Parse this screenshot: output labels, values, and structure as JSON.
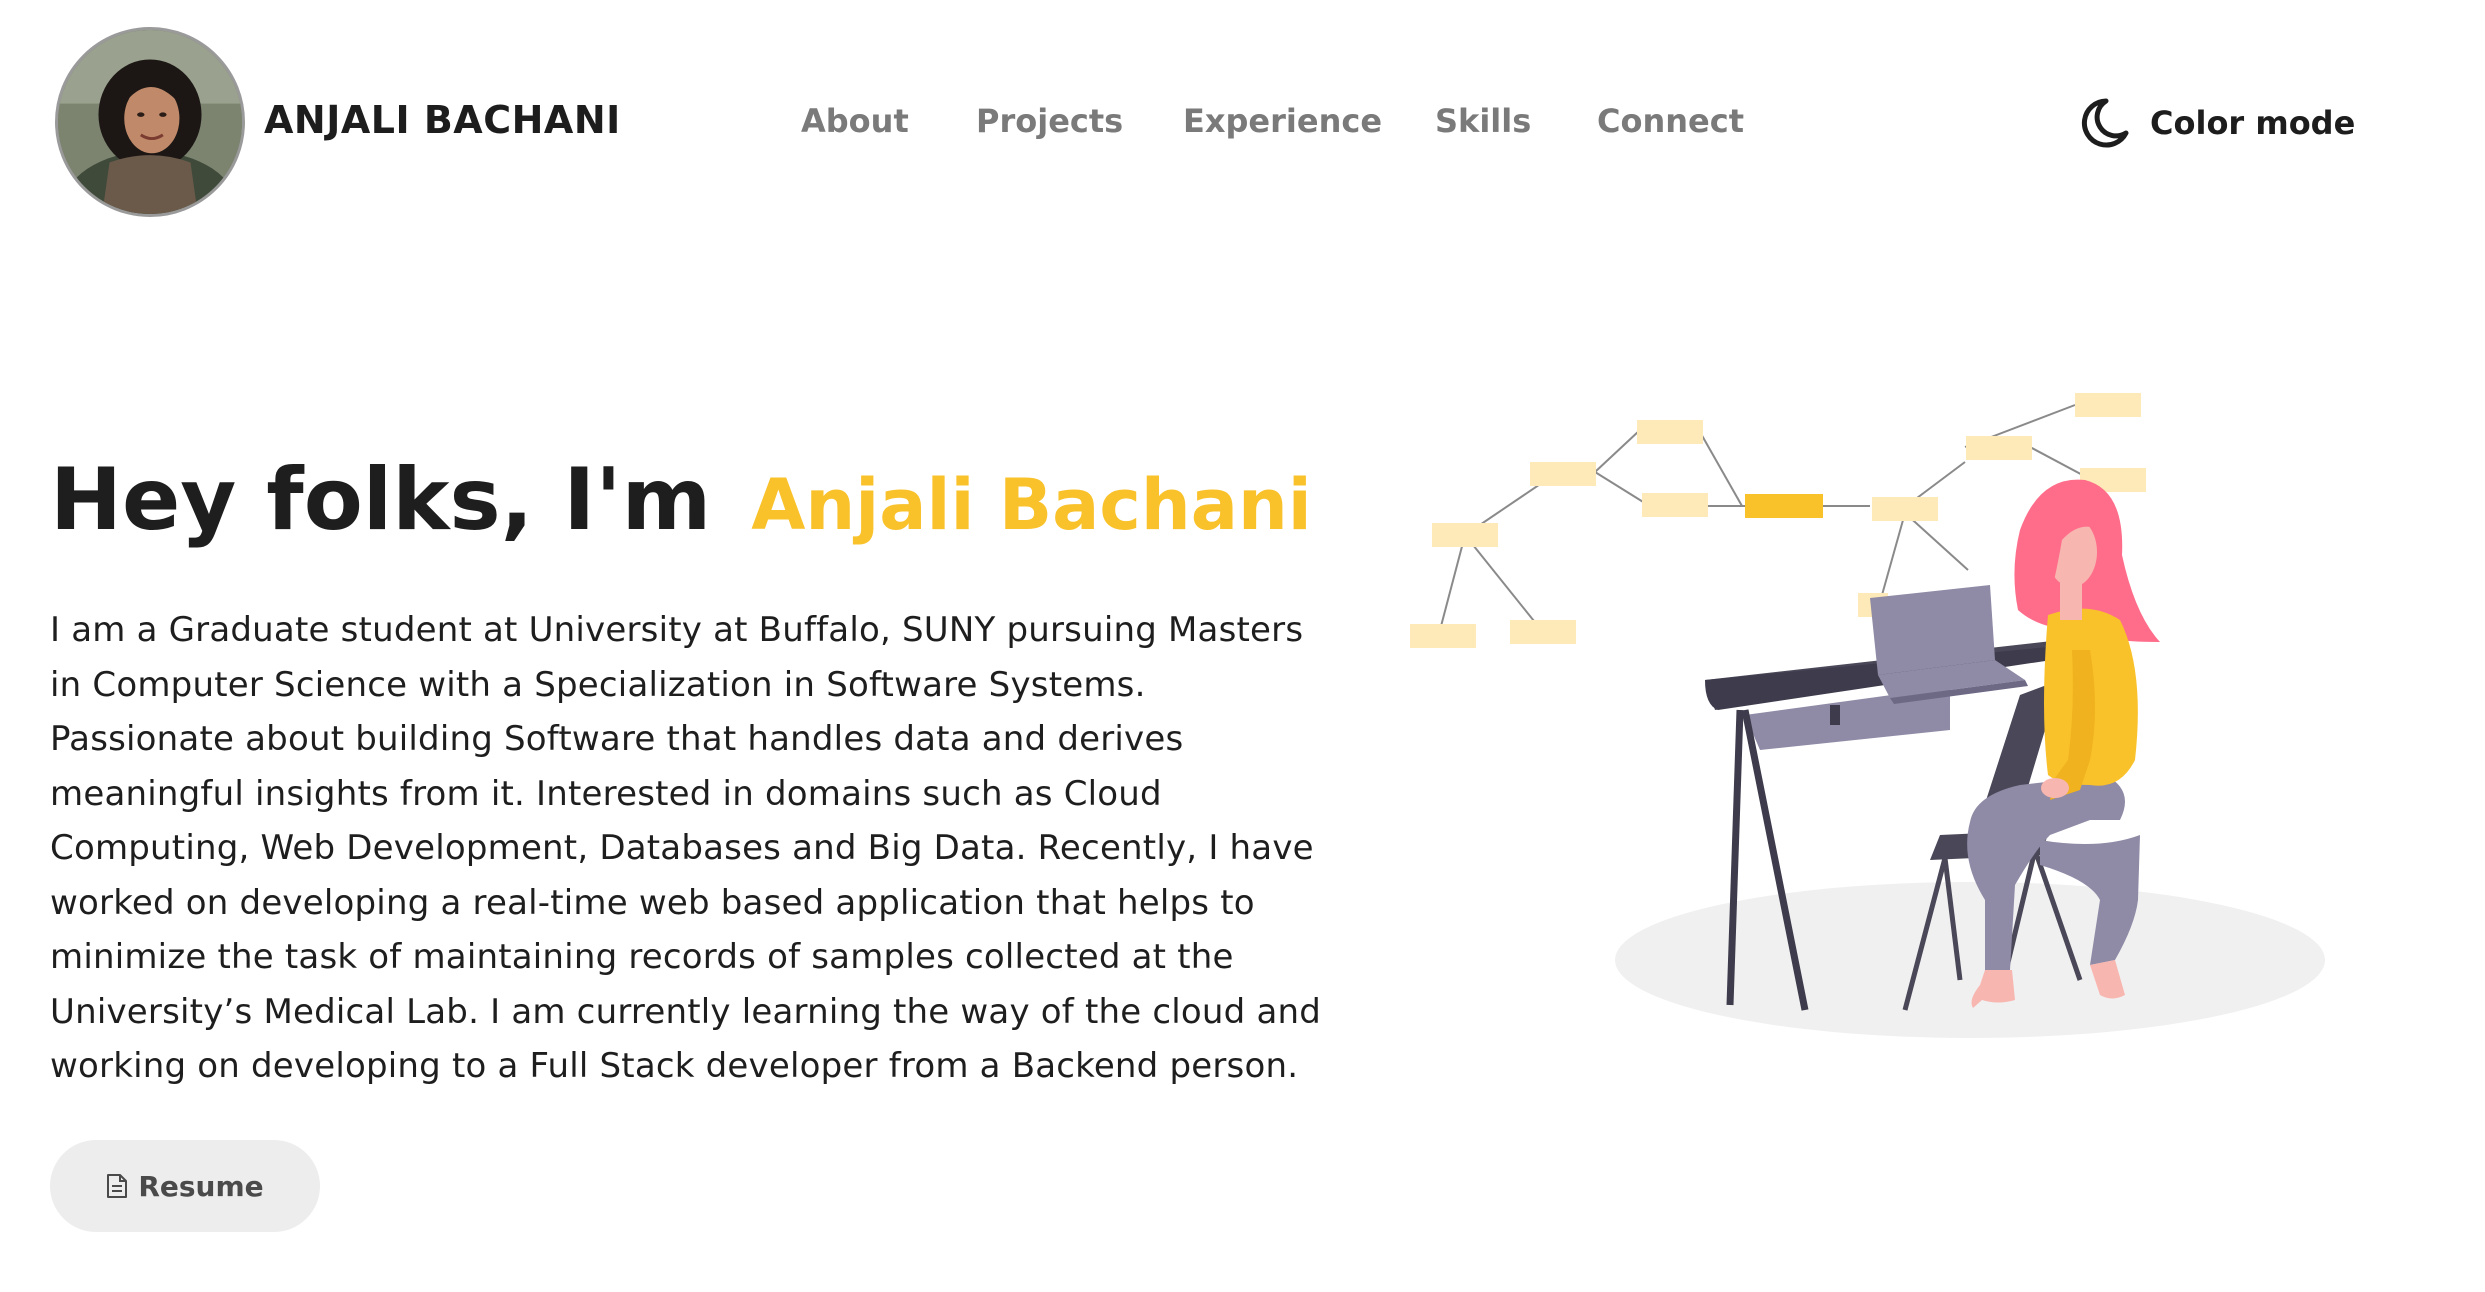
{
  "header": {
    "brand_name": "ANJALI BACHANI",
    "nav": [
      {
        "label": "About"
      },
      {
        "label": "Projects"
      },
      {
        "label": "Experience"
      },
      {
        "label": "Skills"
      },
      {
        "label": "Connect"
      }
    ],
    "color_mode_label": "Color mode",
    "color_mode_icon": "moon-icon"
  },
  "hero": {
    "greeting": "Hey folks, I'm",
    "name": "Anjali Bachani",
    "bio": "I am a Graduate student at University at Buffalo, SUNY pursuing Masters in Computer Science with a Specialization in Software Systems. Passionate about building Software that handles data and derives meaningful insights from it. Interested in domains such as Cloud Computing, Web Development, Databases and Big Data. Recently, I have worked on developing a real-time web based application that helps to minimize the task of maintaining records of samples collected at the University’s Medical Lab. I am currently learning the way of the cloud and working on developing to a Full Stack developer from a Backend person.",
    "resume_label": "Resume",
    "resume_icon": "document-icon"
  },
  "colors": {
    "accent": "#f9c12a",
    "text": "#1e1e1e",
    "nav_text": "#7a7a7a",
    "button_bg": "#ededed"
  }
}
